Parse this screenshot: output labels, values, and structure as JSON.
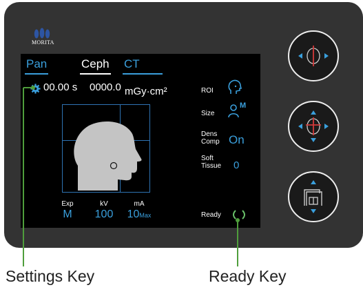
{
  "brand": {
    "name": "MORITA"
  },
  "tabs": [
    {
      "label": "Pan",
      "active": false
    },
    {
      "label": "Ceph",
      "active": true
    },
    {
      "label": "CT",
      "active": false
    }
  ],
  "readout": {
    "time": "00.00 s",
    "dose": "0000.0",
    "dose_unit": "mGy·cm²"
  },
  "params": {
    "exp": {
      "label": "Exp",
      "value": "M"
    },
    "kv": {
      "label": "kV",
      "value": "100"
    },
    "ma": {
      "label": "mA",
      "value": "10",
      "sub": "Max"
    }
  },
  "side": {
    "roi_label": "ROI",
    "size_label": "Size",
    "size_value": "M",
    "dens_label_1": "Dens",
    "dens_label_2": "Comp",
    "dens_value": "On",
    "soft_label_1": "Soft",
    "soft_label_2": "Tissue",
    "soft_value": "0",
    "ready_label": "Ready"
  },
  "callouts": {
    "settings": "Settings Key",
    "ready": "Ready Key"
  },
  "colors": {
    "accent_blue": "#3a9fdc",
    "ready_green": "#6ac26a",
    "callout_green": "#4f9e3c",
    "red_marker": "#d23a3a"
  }
}
